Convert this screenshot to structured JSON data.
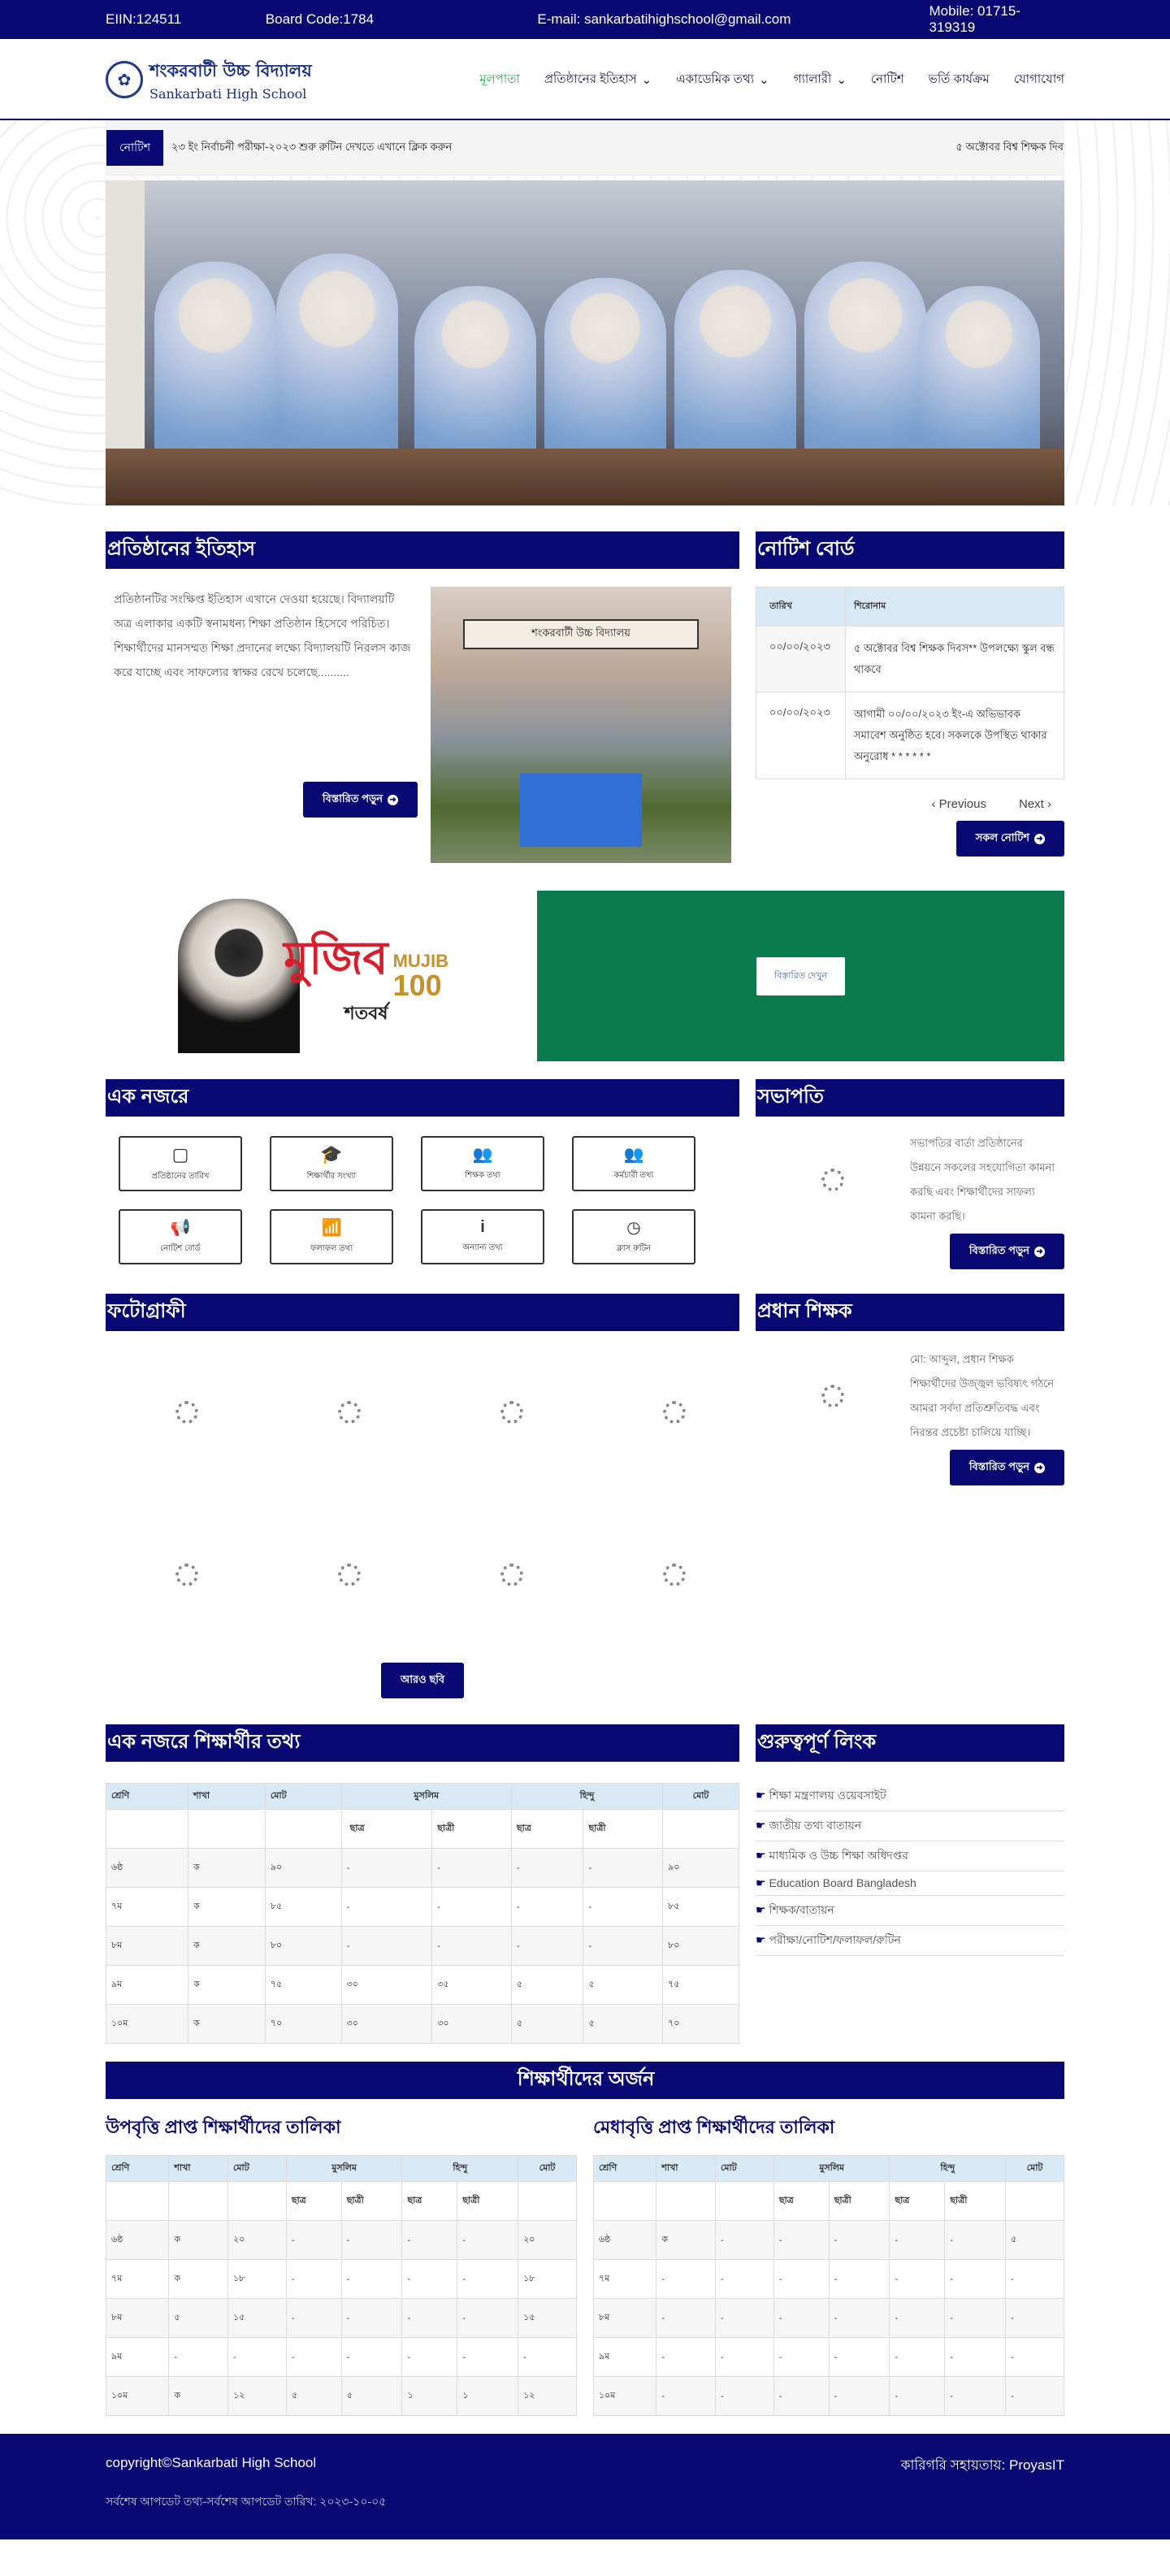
{
  "topbar": {
    "eiin": "EIIN:124511",
    "board": "Board Code:1784",
    "email": "E-mail: sankarbatihighschool@gmail.com",
    "mobile": "Mobile: 01715-319319"
  },
  "logo": {
    "line1": "শংকরবাটী উচ্চ বিদ্যালয়",
    "line2": "Sankarbati High School"
  },
  "menu": [
    {
      "label": "মূলপাতা"
    },
    {
      "label": "প্রতিষ্ঠানের ইতিহাস"
    },
    {
      "label": "একাডেমিক তথ্য"
    },
    {
      "label": "গ্যালারী"
    },
    {
      "label": "নোটিশ"
    },
    {
      "label": "ভর্তি কার্যক্রম"
    },
    {
      "label": "যোগাযোগ"
    }
  ],
  "ticker": {
    "tag": "নোটিশ",
    "text": "২৩ ইং নির্বাচনী পরীক্ষা-২০২৩ শুরু রুটিন দেখতে এখানে ক্লিক করুন",
    "text2": "৫ অক্টোবর বিশ্ব শিক্ষক দিব"
  },
  "history": {
    "title": "প্রতিষ্ঠানের ইতিহাস",
    "body": "প্রতিষ্ঠানটির সংক্ষিপ্ত ইতিহাস এখানে দেওয়া হয়েছে। বিদ্যালয়টি অত্র এলাকার একটি স্বনামধন্য শিক্ষা প্রতিষ্ঠান হিসেবে পরিচিত। শিক্ষার্থীদের মানসম্মত শিক্ষা প্রদানের লক্ষ্যে বিদ্যালয়টি নিরলস কাজ করে যাচ্ছে এবং সাফল্যের স্বাক্ষর রেখে চলেছে..........",
    "button": "বিস্তারিত পড়ুন",
    "school_sign": "শংকরবাটী উচ্চ বিদ্যালয়"
  },
  "notice_board": {
    "title": "নোটিশ বোর্ড",
    "headers": [
      "তারিখ",
      "শিরোনাম"
    ],
    "rows": [
      {
        "date": "০০/০০/২০২৩",
        "title": "৫ অক্টোবর বিশ্ব শিক্ষক দিবস** উপলক্ষ্যে স্কুল বন্ধ থাকবে"
      },
      {
        "date": "০০/০০/২০২৩",
        "title": "আগামী ০০/০০/২০২৩ ইং-এ অভিভাবক সমাবেশ অনুষ্ঠিত হবে। সকলকে উপস্থিত থাকার অনুরোধ * * * * * *"
      }
    ],
    "prev": "Previous",
    "next": "Next",
    "all": "সকল নোটিশ"
  },
  "mujib": {
    "word": "মুজিব",
    "sub": "শতবর্ষ",
    "en": "MUJIB",
    "num": "100"
  },
  "green_button": "বিস্তারিত দেখুন",
  "glance": {
    "title": "এক নজরে",
    "items": [
      {
        "label": "প্রতিষ্ঠানের তারিখ"
      },
      {
        "label": "শিক্ষার্থীর সংখ্যা"
      },
      {
        "label": "শিক্ষক তথ্য"
      },
      {
        "label": "কর্মচারী তথ্য"
      },
      {
        "label": "নোটিশ বোর্ড"
      },
      {
        "label": "ফলাফল তথ্য"
      },
      {
        "label": "অন্যান্য তথ্য"
      },
      {
        "label": "ক্লাস রুটিন"
      }
    ]
  },
  "president": {
    "title": "সভাপতি",
    "body": "সভাপতির বার্তা প্রতিষ্ঠানের উন্নয়নে সকলের সহযোগিতা কামনা করছি এবং শিক্ষার্থীদের সাফল্য কামনা করছি।",
    "button": "বিস্তারিত পড়ুন"
  },
  "photo": {
    "title": "ফটোগ্রাফী",
    "more": "আরও ছবি"
  },
  "head": {
    "title": "প্রধান শিক্ষক",
    "body": "মো: আব্দুল, প্রধান শিক্ষক শিক্ষার্থীদের উজ্জ্বল ভবিষ্যৎ গঠনে আমরা সর্বদা প্রতিশ্রুতিবদ্ধ এবং নিরন্তর প্রচেষ্টা চালিয়ে যাচ্ছি।",
    "button": "বিস্তারিত পড়ুন"
  },
  "student_info": {
    "title": "এক নজরে শিক্ষার্থীর তথ্য",
    "h1": [
      "শ্রেণি",
      "শাখা",
      "মোট",
      "মুসলিম",
      "হিন্দু",
      "মোট"
    ],
    "h2": [
      "ছাত্র",
      "ছাত্রী",
      "ছাত্র",
      "ছাত্রী"
    ],
    "rows": [
      [
        "৬ষ্ঠ",
        "ক",
        "৯০",
        "-",
        "-",
        "-",
        "-",
        "৯০"
      ],
      [
        "৭ম",
        "ক",
        "৮৫",
        "-",
        "-",
        "-",
        "-",
        "৮৫"
      ],
      [
        "৮ম",
        "ক",
        "৮০",
        "-",
        "-",
        "-",
        "-",
        "৮০"
      ],
      [
        "৯ম",
        "ক",
        "৭৫",
        "৩০",
        "৩৫",
        "৫",
        "৫",
        "৭৫"
      ],
      [
        "১০ম",
        "ক",
        "৭০",
        "৩০",
        "৩০",
        "৫",
        "৫",
        "৭০"
      ]
    ]
  },
  "links": {
    "title": "গুরুত্বপূর্ণ লিংক",
    "items": [
      "শিক্ষা মন্ত্রণালয় ওয়েবসাইট",
      "জাতীয় তথ্য বাতায়ন",
      "মাধ্যমিক ও উচ্চ শিক্ষা অধিদপ্তর",
      "Education Board Bangladesh",
      "শিক্ষক/বাতায়ন",
      "পরীক্ষা/নোটিশ/ফলাফল/রুটিন"
    ]
  },
  "achievement": {
    "title": "শিক্ষার্থীদের অর্জন",
    "left_title": "উপবৃত্তি প্রাপ্ত শিক্ষার্থীদের তালিকা",
    "right_title": "মেধাবৃত্তি প্রাপ্ত শিক্ষার্থীদের তালিকা",
    "h1": [
      "শ্রেণি",
      "শাখা",
      "মোট",
      "মুসলিম",
      "হিন্দু",
      "মোট"
    ],
    "h2": [
      "ছাত্র",
      "ছাত্রী",
      "ছাত্র",
      "ছাত্রী"
    ],
    "left_rows": [
      [
        "৬ষ্ঠ",
        "ক",
        "২০",
        "-",
        "-",
        "-",
        "-",
        "২০"
      ],
      [
        "৭ম",
        "ক",
        "১৮",
        "-",
        "-",
        "-",
        "-",
        "১৮"
      ],
      [
        "৮ম",
        "৫",
        "১৫",
        "-",
        "-",
        "-",
        "-",
        "১৫"
      ],
      [
        "৯ম",
        "-",
        "-",
        "-",
        "-",
        "-",
        "-",
        "-"
      ],
      [
        "১০ম",
        "ক",
        "১২",
        "৫",
        "৫",
        "১",
        "১",
        "১২"
      ]
    ],
    "right_rows": [
      [
        "৬ষ্ঠ",
        "ক",
        "-",
        "-",
        "-",
        "-",
        "-",
        "৫"
      ],
      [
        "৭ম",
        "-",
        "-",
        "-",
        "-",
        "-",
        "-",
        "-"
      ],
      [
        "৮ম",
        "-",
        "-",
        "-",
        "-",
        "-",
        "-",
        "-"
      ],
      [
        "৯ম",
        "-",
        "-",
        "-",
        "-",
        "-",
        "-",
        "-"
      ],
      [
        "১০ম",
        "-",
        "-",
        "-",
        "-",
        "-",
        "-",
        "-"
      ]
    ]
  },
  "footer": {
    "copyright": "copyright©Sankarbati High School",
    "dev": "কারিগরি সহায়তায়: ProyasIT",
    "update": "সর্বশেষ আপডেট তথ্য-সর্বশেষ আপডেট তারিখ: ২০২৩-১০-০৫"
  }
}
